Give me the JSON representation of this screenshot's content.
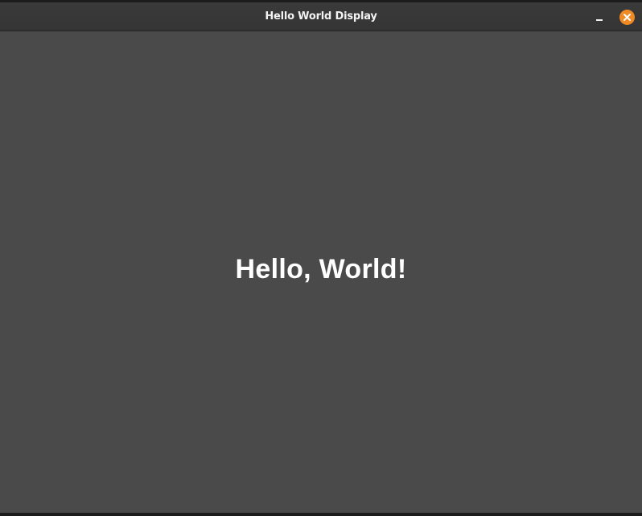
{
  "window": {
    "title": "Hello World Display"
  },
  "content": {
    "message": "Hello, World!"
  },
  "controls": {
    "minimize_icon": "minimize-icon",
    "close_icon": "close-icon",
    "close_color": "#f08a24"
  },
  "colors": {
    "background": "#4a4a4a",
    "titlebar": "#383838",
    "text": "#ffffff"
  }
}
